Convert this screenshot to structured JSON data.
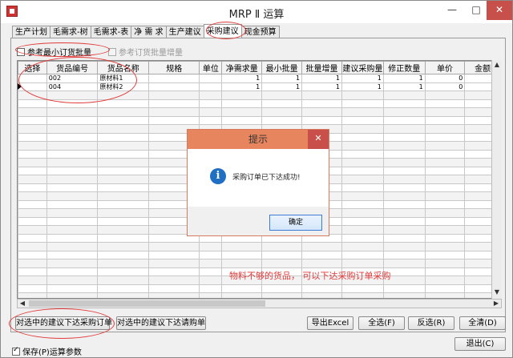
{
  "window": {
    "title": "MRP Ⅱ 运算"
  },
  "window_controls": {
    "minimize": "—",
    "maximize": "□",
    "close": "✕"
  },
  "tabs": [
    {
      "label": "生产计划"
    },
    {
      "label": "毛需求-树"
    },
    {
      "label": "毛需求-表"
    },
    {
      "label": "净 需 求"
    },
    {
      "label": "生产建议"
    },
    {
      "label": "采购建议",
      "active": true
    },
    {
      "label": "现金预算"
    }
  ],
  "options": {
    "ref_min_order": {
      "label": "参考最小订货批量",
      "checked": false
    },
    "ref_order_increment": {
      "label": "参考订货批量增量",
      "checked": false,
      "disabled": true
    }
  },
  "grid": {
    "columns": [
      "选择",
      "货品编号",
      "货品名称",
      "规格",
      "单位",
      "净需求量",
      "最小批量",
      "批量增量",
      "建议采购量",
      "修正数量",
      "单价",
      "金额"
    ],
    "rows": [
      [
        "",
        "002",
        "原材料1",
        "",
        "",
        "1",
        "1",
        "1",
        "1",
        "1",
        "0",
        ""
      ],
      [
        "",
        "004",
        "原材料2",
        "",
        "",
        "1",
        "1",
        "1",
        "1",
        "1",
        "0",
        ""
      ]
    ]
  },
  "buttons": {
    "create_po": "对选中的建议下达采购订单",
    "create_req": "对选中的建议下达请购单",
    "export_excel": "导出Excel",
    "select_all": "全选(F)",
    "invert": "反选(R)",
    "clear_all": "全清(D)",
    "exit": "退出(C)"
  },
  "save_params": {
    "label": "保存(P)运算参数",
    "checked": true
  },
  "dialog": {
    "title": "提示",
    "close": "✕",
    "icon": "info-icon",
    "icon_glyph": "i",
    "message": "采购订单已下达成功!",
    "ok": "确定"
  },
  "annotation": "物料不够的货品， 可以下达采购订单采购",
  "colors": {
    "annotation": "#e03a3a",
    "dialog_title": "#e6855e",
    "close_button": "#c9504a",
    "info_icon": "#1f6fc4"
  }
}
